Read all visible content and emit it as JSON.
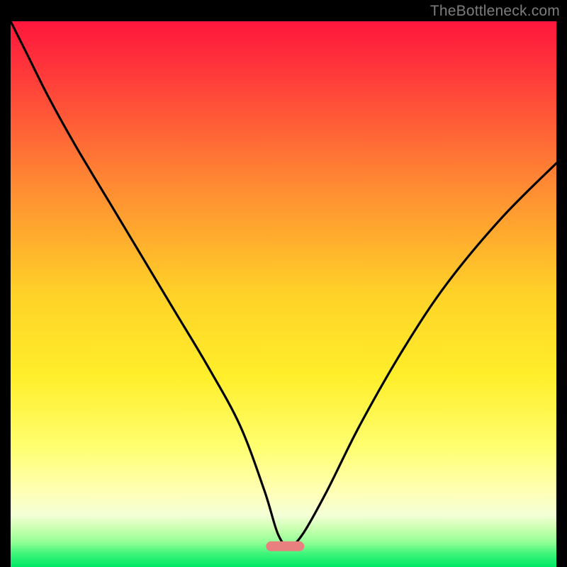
{
  "watermark": "TheBottleneck.com",
  "chart_data": {
    "type": "line",
    "title": "",
    "xlabel": "",
    "ylabel": "",
    "xlim": [
      0,
      100
    ],
    "ylim": [
      0,
      100
    ],
    "background_gradient": {
      "stops": [
        {
          "offset": 0.0,
          "color": "#ff173d"
        },
        {
          "offset": 0.1,
          "color": "#ff3b3a"
        },
        {
          "offset": 0.3,
          "color": "#ff8a33"
        },
        {
          "offset": 0.5,
          "color": "#ffd228"
        },
        {
          "offset": 0.65,
          "color": "#ffee2a"
        },
        {
          "offset": 0.78,
          "color": "#ffff70"
        },
        {
          "offset": 0.86,
          "color": "#ffffb4"
        },
        {
          "offset": 0.905,
          "color": "#f4ffd6"
        },
        {
          "offset": 0.93,
          "color": "#c8ffb0"
        },
        {
          "offset": 0.955,
          "color": "#90ff95"
        },
        {
          "offset": 0.975,
          "color": "#40f57a"
        },
        {
          "offset": 1.0,
          "color": "#00e765"
        }
      ]
    },
    "series": [
      {
        "name": "bottleneck-curve",
        "type": "line",
        "color": "#000000",
        "x": [
          0,
          3,
          7,
          12,
          18,
          24,
          30,
          36,
          42,
          46.5,
          49,
          51,
          53.5,
          58,
          64,
          72,
          80,
          90,
          100
        ],
        "y": [
          100,
          94,
          86,
          77,
          67,
          57,
          47,
          37,
          26,
          14,
          6,
          3.8,
          6,
          14,
          26,
          40,
          52,
          64,
          74
        ]
      }
    ],
    "marker": {
      "name": "optimal-band",
      "shape": "pill",
      "color": "#e98080",
      "x_center": 50.3,
      "y_center": 3.8,
      "width": 7.0,
      "height": 1.8
    }
  }
}
